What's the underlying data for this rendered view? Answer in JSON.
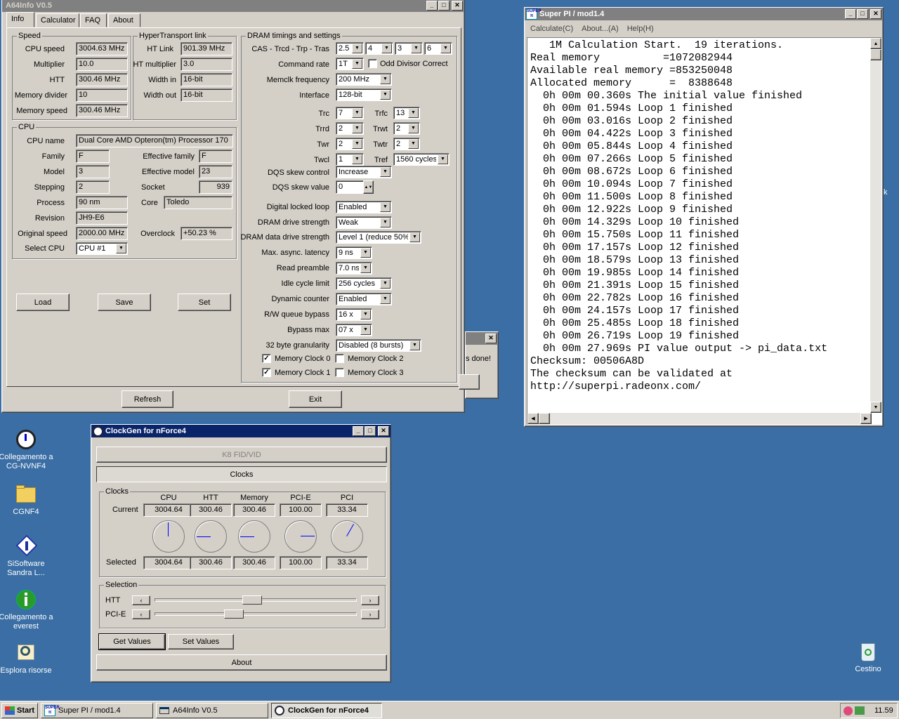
{
  "a64": {
    "title": "A64Info V0.5",
    "tabs": [
      "Info",
      "Calculator",
      "FAQ",
      "About"
    ],
    "speed": {
      "title": "Speed",
      "rows": [
        {
          "label": "CPU speed",
          "value": "3004.63 MHz"
        },
        {
          "label": "Multiplier",
          "value": "10.0"
        },
        {
          "label": "HTT",
          "value": "300.46 MHz"
        },
        {
          "label": "Memory divider",
          "value": "10"
        },
        {
          "label": "Memory speed",
          "value": "300.46 MHz"
        }
      ]
    },
    "ht": {
      "title": "HyperTransport link",
      "rows": [
        {
          "label": "HT Link",
          "value": "901.39 MHz"
        },
        {
          "label": "HT multiplier",
          "value": "3.0"
        },
        {
          "label": "Width in",
          "value": "16-bit"
        },
        {
          "label": "Width out",
          "value": "16-bit"
        }
      ]
    },
    "cpu": {
      "title": "CPU",
      "name_label": "CPU name",
      "name": "Dual Core AMD Opteron(tm) Processor 170",
      "family_label": "Family",
      "family": "F",
      "efamily_label": "Effective family",
      "efamily": "F",
      "model_label": "Model",
      "model": "3",
      "emodel_label": "Effective model",
      "emodel": "23",
      "stepping_label": "Stepping",
      "stepping": "2",
      "socket_label": "Socket",
      "socket": "939",
      "process_label": "Process",
      "process": "90 nm",
      "core_label": "Core",
      "core": "Toledo",
      "revision_label": "Revision",
      "revision": "JH9-E6",
      "orig_label": "Original speed",
      "orig": "2000.00 MHz",
      "oc_label": "Overclock",
      "oc": "+50.23 %",
      "selcpu_label": "Select CPU",
      "selcpu": "CPU #1"
    },
    "dram": {
      "title": "DRAM timings and settings",
      "cas_label": "CAS - Trcd - Trp - Tras",
      "cas": [
        "2.5",
        "4",
        "3",
        "6"
      ],
      "cmd_label": "Command rate",
      "cmd": "1T",
      "odd_label": "Odd Divisor Correct",
      "memclk_label": "Memclk frequency",
      "memclk": "200 MHz",
      "iface_label": "Interface",
      "iface": "128-bit",
      "trc_label": "Trc",
      "trc": "7",
      "trfc_label": "Trfc",
      "trfc": "13",
      "trrd_label": "Trrd",
      "trrd": "2",
      "trwt_label": "Trwt",
      "trwt": "2",
      "twr_label": "Twr",
      "twr": "2",
      "twtr_label": "Twtr",
      "twtr": "2",
      "twcl_label": "Twcl",
      "twcl": "1",
      "tref_label": "Tref",
      "tref": "1560 cycles",
      "dqsc_label": "DQS skew control",
      "dqsc": "Increase",
      "dqsv_label": "DQS skew value",
      "dqsv": "0",
      "dll_label": "Digital locked loop",
      "dll": "Enabled",
      "dds_label": "DRAM drive strength",
      "dds": "Weak",
      "ddds_label": "DRAM data drive strength",
      "ddds": "Level 1 (reduce 50%)",
      "mal_label": "Max. async. latency",
      "mal": "9 ns",
      "rp_label": "Read preamble",
      "rp": "7.0 ns",
      "icl_label": "Idle cycle limit",
      "icl": "256 cycles",
      "dc_label": "Dynamic counter",
      "dc": "Enabled",
      "rwq_label": "R/W queue bypass",
      "rwq": "16 x",
      "bm_label": "Bypass max",
      "bm": "07 x",
      "gran_label": "32 byte granularity",
      "gran": "Disabled (8 bursts)",
      "mc0": "Memory Clock 0",
      "mc1": "Memory Clock 1",
      "mc2": "Memory Clock 2",
      "mc3": "Memory Clock 3"
    },
    "buttons": {
      "load": "Load",
      "save": "Save",
      "set": "Set",
      "refresh": "Refresh",
      "exit": "Exit"
    }
  },
  "hidden_dialog": {
    "text": "s done!"
  },
  "superpi": {
    "title": "Super PI / mod1.4",
    "menu": [
      "Calculate(C)",
      "About...(A)",
      "Help(H)"
    ],
    "lines": [
      "   1M Calculation Start.  19 iterations.",
      "Real memory          =1072082944",
      "Available real memory =853250048",
      "Allocated memory      =  8388648",
      "  0h 00m 00.360s The initial value finished",
      "  0h 00m 01.594s Loop 1 finished",
      "  0h 00m 03.016s Loop 2 finished",
      "  0h 00m 04.422s Loop 3 finished",
      "  0h 00m 05.844s Loop 4 finished",
      "  0h 00m 07.266s Loop 5 finished",
      "  0h 00m 08.672s Loop 6 finished",
      "  0h 00m 10.094s Loop 7 finished",
      "  0h 00m 11.500s Loop 8 finished",
      "  0h 00m 12.922s Loop 9 finished",
      "  0h 00m 14.329s Loop 10 finished",
      "  0h 00m 15.750s Loop 11 finished",
      "  0h 00m 17.157s Loop 12 finished",
      "  0h 00m 18.579s Loop 13 finished",
      "  0h 00m 19.985s Loop 14 finished",
      "  0h 00m 21.391s Loop 15 finished",
      "  0h 00m 22.782s Loop 16 finished",
      "  0h 00m 24.157s Loop 17 finished",
      "  0h 00m 25.485s Loop 18 finished",
      "  0h 00m 26.719s Loop 19 finished",
      "  0h 00m 27.969s PI value output -> pi_data.txt",
      "",
      "Checksum: 00506A8D",
      "The checksum can be validated at",
      "http://superpi.radeonx.com/"
    ]
  },
  "clockgen": {
    "title": "ClockGen for nForce4",
    "k8": "K8 FID/VID",
    "clocks_btn": "Clocks",
    "clocks_group": "Clocks",
    "cols": [
      "CPU",
      "HTT",
      "Memory",
      "PCI-E",
      "PCI"
    ],
    "current_label": "Current",
    "current": [
      "3004.64",
      "300.46",
      "300.46",
      "100.00",
      "33.34"
    ],
    "selected_label": "Selected",
    "selected": [
      "3004.64",
      "300.46",
      "300.46",
      "100.00",
      "33.34"
    ],
    "selection_group": "Selection",
    "htt_label": "HTT",
    "pcie_label": "PCI-E",
    "htt_pos": 0.48,
    "pcie_pos": 0.38,
    "get": "Get Values",
    "set": "Set Values",
    "about": "About"
  },
  "desktop": {
    "icons": [
      {
        "name": "cg-nvnf4",
        "label": "Collegamento a CG-NVNF4"
      },
      {
        "name": "cgnf4",
        "label": "CGNF4"
      },
      {
        "name": "sandra",
        "label": "SiSoftware Sandra L..."
      },
      {
        "name": "everest",
        "label": "Collegamento a everest"
      },
      {
        "name": "explorer",
        "label": "Esplora risorse"
      }
    ],
    "recycle": "Cestino"
  },
  "taskbar": {
    "start": "Start",
    "items": [
      "Super PI / mod1.4",
      "A64Info V0.5",
      "ClockGen for nForce4"
    ],
    "clock": "11.59"
  }
}
